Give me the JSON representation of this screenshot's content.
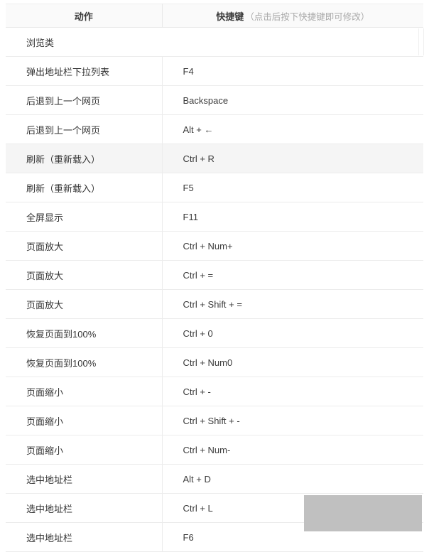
{
  "table": {
    "headers": {
      "action": "动作",
      "shortcut_main": "快捷键",
      "shortcut_note": "（点击后按下快捷键即可修改）"
    },
    "group_label": "浏览类",
    "rows": [
      {
        "action": "弹出地址栏下拉列表",
        "shortcut": "F4",
        "highlight": false
      },
      {
        "action": "后退到上一个网页",
        "shortcut": "Backspace",
        "highlight": false
      },
      {
        "action": "后退到上一个网页",
        "shortcut": "Alt + ←",
        "highlight": false
      },
      {
        "action": "刷新（重新载入）",
        "shortcut": "Ctrl + R",
        "highlight": true
      },
      {
        "action": "刷新（重新载入）",
        "shortcut": "F5",
        "highlight": false
      },
      {
        "action": "全屏显示",
        "shortcut": "F11",
        "highlight": false
      },
      {
        "action": "页面放大",
        "shortcut": "Ctrl + Num+",
        "highlight": false
      },
      {
        "action": "页面放大",
        "shortcut": "Ctrl + =",
        "highlight": false
      },
      {
        "action": "页面放大",
        "shortcut": "Ctrl + Shift + =",
        "highlight": false
      },
      {
        "action": "恢复页面到100%",
        "shortcut": "Ctrl + 0",
        "highlight": false
      },
      {
        "action": "恢复页面到100%",
        "shortcut": "Ctrl + Num0",
        "highlight": false
      },
      {
        "action": "页面缩小",
        "shortcut": "Ctrl + -",
        "highlight": false
      },
      {
        "action": "页面缩小",
        "shortcut": "Ctrl + Shift + -",
        "highlight": false
      },
      {
        "action": "页面缩小",
        "shortcut": "Ctrl + Num-",
        "highlight": false
      },
      {
        "action": "选中地址栏",
        "shortcut": "Alt + D",
        "highlight": false
      },
      {
        "action": "选中地址栏",
        "shortcut": "Ctrl + L",
        "highlight": false
      },
      {
        "action": "选中地址栏",
        "shortcut": "F6",
        "highlight": false
      }
    ]
  },
  "colors": {
    "header_background": "#fafafa",
    "row_highlight": "#f5f5f5",
    "border": "#ececec",
    "text_primary": "#333333",
    "text_muted": "#a9a9a9",
    "overlay": "#c0c0c0"
  }
}
